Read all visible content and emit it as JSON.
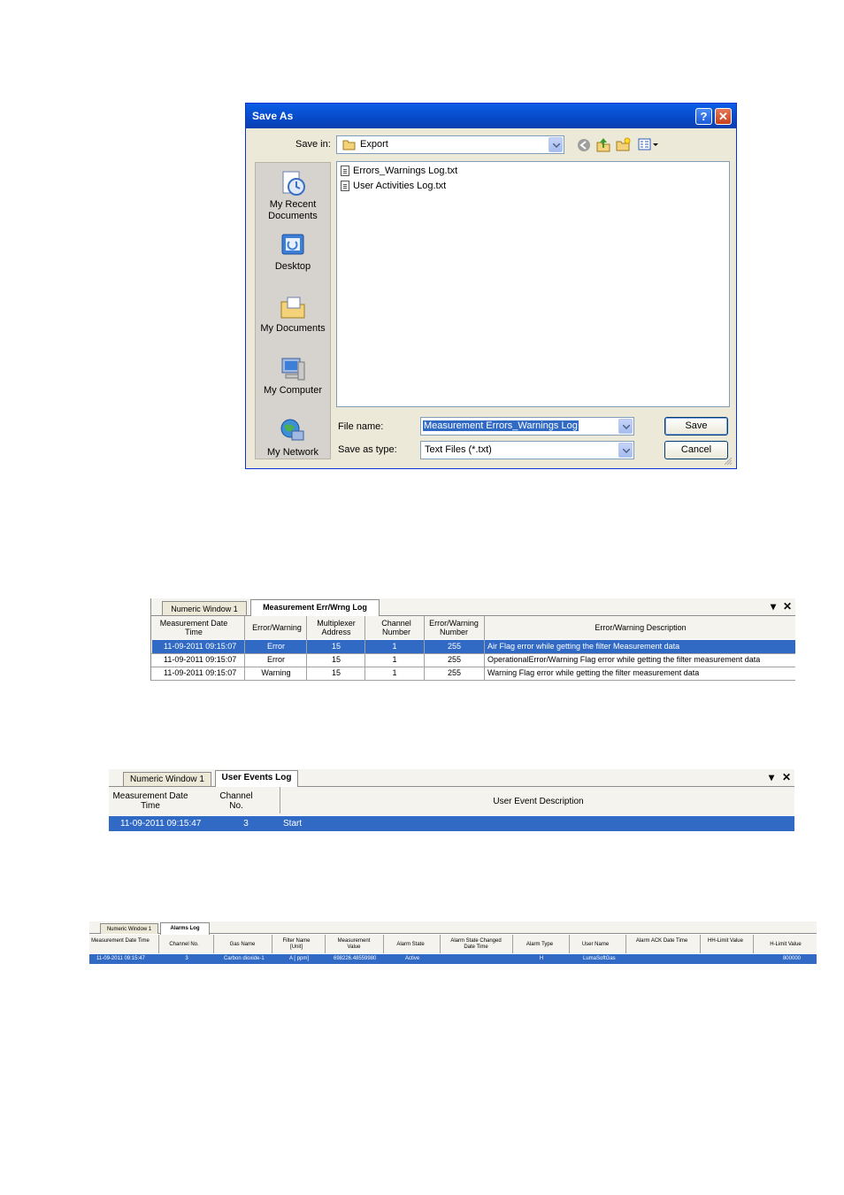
{
  "save_dialog": {
    "title": "Save As",
    "help_glyph": "?",
    "close_glyph": "✕",
    "save_in_label": "Save in:",
    "save_in_value": "Export",
    "places": [
      {
        "label": "My Recent Documents",
        "icon": "recent-documents-icon"
      },
      {
        "label": "Desktop",
        "icon": "desktop-icon"
      },
      {
        "label": "My Documents",
        "icon": "my-documents-icon"
      },
      {
        "label": "My Computer",
        "icon": "my-computer-icon"
      },
      {
        "label": "My Network",
        "icon": "my-network-icon"
      }
    ],
    "files": [
      "Errors_Warnings Log.txt",
      "User Activities Log.txt"
    ],
    "file_name_label": "File name:",
    "file_name_value": "Measurement Errors_Warnings Log",
    "save_type_label": "Save as type:",
    "save_type_value": "Text  Files (*.txt)",
    "save_button": "Save",
    "cancel_button": "Cancel"
  },
  "err_panel": {
    "tabs": [
      "Numeric Window 1",
      "Measurement Err/Wrng Log"
    ],
    "columns": [
      "Measurement Date Time",
      "Error/Warning",
      "Multiplexer Address",
      "Channel Number",
      "Error/Warning Number",
      "Error/Warning Description"
    ],
    "rows": [
      [
        "11-09-2011 09:15:07",
        "Error",
        "15",
        "1",
        "255",
        "Air Flag error while getting the filter Measurement data"
      ],
      [
        "11-09-2011 09:15:07",
        "Error",
        "15",
        "1",
        "255",
        "OperationalError/Warning Flag error while getting the filter measurement data"
      ],
      [
        "11-09-2011 09:15:07",
        "Warning",
        "15",
        "1",
        "255",
        "Warning Flag error while getting the filter measurement data"
      ]
    ],
    "pin_glyph": "▾",
    "close_glyph": "✕"
  },
  "events_panel": {
    "tabs": [
      "Numeric Window 1",
      "User Events Log"
    ],
    "columns": [
      "Measurement Date Time",
      "Channel No.",
      "User Event Description"
    ],
    "rows": [
      [
        "11-09-2011 09:15:47",
        "3",
        "Start"
      ]
    ],
    "pin_glyph": "▾",
    "close_glyph": "✕"
  },
  "alarms_panel": {
    "tabs": [
      "Numeric Window 1",
      "Alarms Log"
    ],
    "columns": [
      "Measurement Date Time",
      "Channel No.",
      "Gas Name",
      "Filter Name [Unit]",
      "Measurement Value",
      "Alarm State",
      "Alarm State Changed Date Time",
      "Alarm Type",
      "User Name",
      "Alarm ACK Date Time",
      "HH-Limit Value",
      "H-Limit Value"
    ],
    "rows": [
      [
        "11-09-2011 09:15:47",
        "3",
        "Carbon dioxide-1",
        "A [ ppm]",
        "698226.48559980",
        "Active",
        "",
        "H",
        "LumaSoftGas",
        "",
        "",
        "800000"
      ]
    ]
  }
}
